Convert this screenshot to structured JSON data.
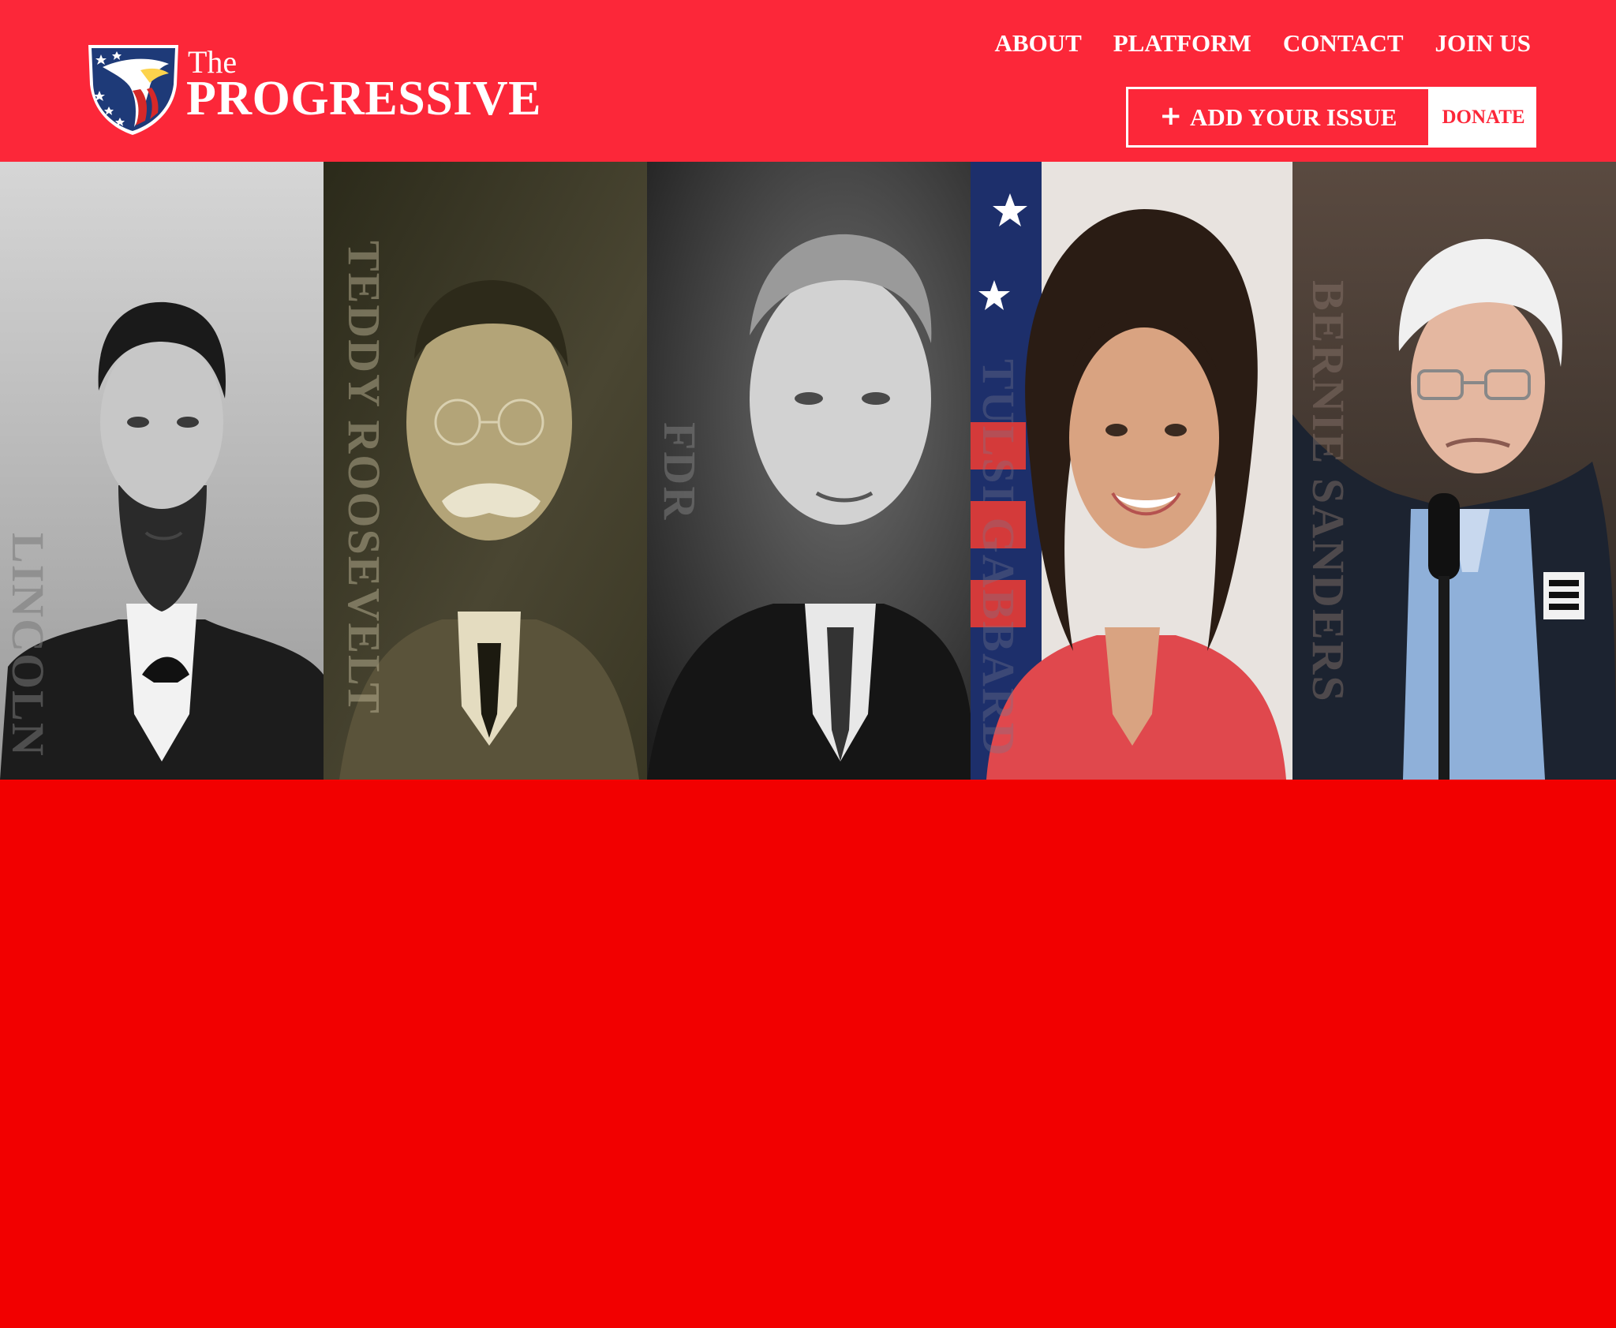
{
  "brand": {
    "the": "The",
    "name": "PROGRESSIVE",
    "logo_icon": "eagle-shield-icon"
  },
  "nav": {
    "items": [
      {
        "label": "ABOUT"
      },
      {
        "label": "PLATFORM"
      },
      {
        "label": "CONTACT"
      },
      {
        "label": "JOIN US"
      }
    ]
  },
  "actions": {
    "add_issue_icon": "plus-icon",
    "add_issue_label": "ADD YOUR ISSUE",
    "donate_label": "DONATE"
  },
  "hero": {
    "portraits": [
      {
        "name": "LINCOLN",
        "tone": "grayscale"
      },
      {
        "name": "TEDDY ROOSEVELT",
        "tone": "sepia"
      },
      {
        "name": "FDR",
        "tone": "grayscale"
      },
      {
        "name": "TULSI GABBARD",
        "tone": "color"
      },
      {
        "name": "BERNIE SANDERS",
        "tone": "color"
      }
    ]
  },
  "colors": {
    "header_bg": "#fc2739",
    "page_bg": "#f20000",
    "text_on_red": "#ffffff",
    "donate_text": "#fc2739",
    "shield_blue": "#1e3a78"
  }
}
